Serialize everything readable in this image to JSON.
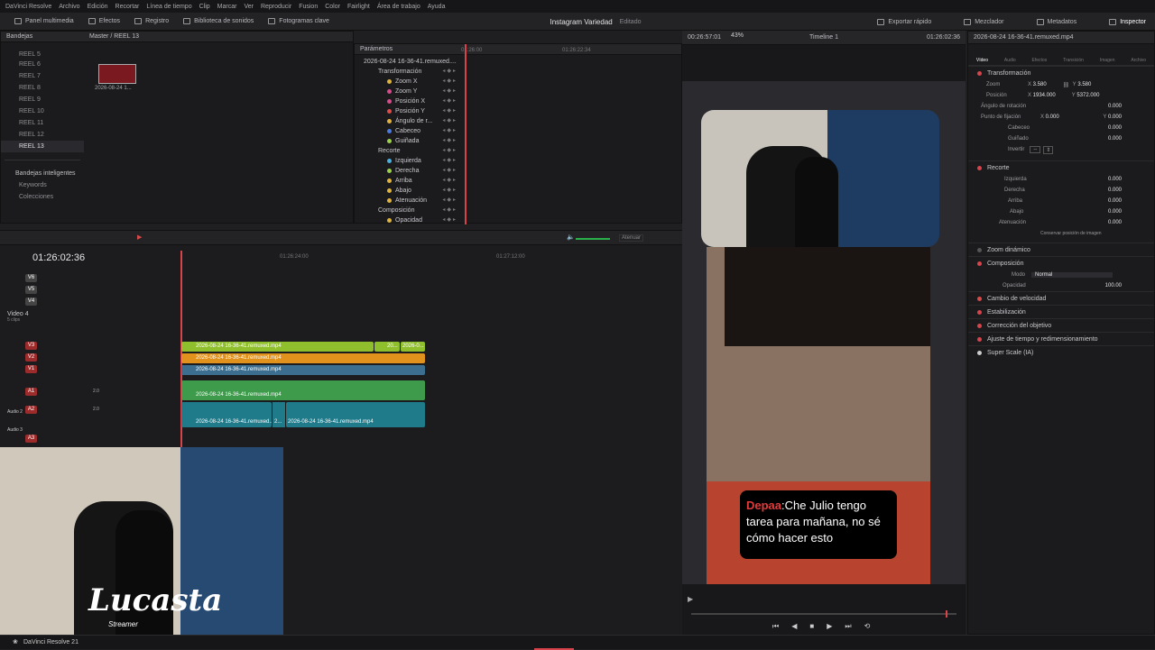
{
  "menubar": {
    "items": [
      "DaVinci Resolve",
      "Archivo",
      "Edición",
      "Recortar",
      "Línea de tiempo",
      "Clip",
      "Marcar",
      "Ver",
      "Reproducir",
      "Fusion",
      "Color",
      "Fairlight",
      "Área de trabajo",
      "Ayuda"
    ]
  },
  "toolbar": {
    "left": [
      "Panel multimedia",
      "Efectos",
      "Registro",
      "Biblioteca de sonidos",
      "Fotogramas clave"
    ],
    "right": [
      "Exportar rápido",
      "Mezclador",
      "Metadatos",
      "Inspector"
    ]
  },
  "project": {
    "title": "Instagram Variedad",
    "status": "Editado"
  },
  "mediapool": {
    "header": "Bandejas",
    "breadcrumb": "Master / REEL 13",
    "reels": [
      "REEL 5",
      "REEL 6",
      "REEL 7",
      "REEL 8",
      "REEL 9",
      "REEL 10",
      "REEL 11",
      "REEL 12",
      "REEL 13"
    ],
    "smart_bins": "Bandejas inteligentes",
    "smart_items": [
      "Keywords",
      "Colecciones"
    ],
    "thumb_label": "2026-08-24 1..."
  },
  "params": {
    "header": "Parámetros",
    "clip": "2026-08-24 16-36-41.remuxed....",
    "time1": "01:26:00",
    "time2": "01:26:22:34",
    "rows": [
      {
        "label": "Transformación",
        "group": true
      },
      {
        "label": "Zoom X",
        "color": "#e0b43c"
      },
      {
        "label": "Zoom Y",
        "color": "#d94a8c"
      },
      {
        "label": "Posición X",
        "color": "#d94a8c"
      },
      {
        "label": "Posición Y",
        "color": "#e04a4a"
      },
      {
        "label": "Ángulo de r...",
        "color": "#e0b43c"
      },
      {
        "label": "Cabeceo",
        "color": "#4a7ae0"
      },
      {
        "label": "Guiñada",
        "color": "#9bd04a"
      },
      {
        "label": "Recorte",
        "group": true
      },
      {
        "label": "Izquierda",
        "color": "#4ab0e0"
      },
      {
        "label": "Derecha",
        "color": "#9bd04a"
      },
      {
        "label": "Arriba",
        "color": "#e0b43c"
      },
      {
        "label": "Abajo",
        "color": "#e0b43c"
      },
      {
        "label": "Atenuación",
        "color": "#e0b43c"
      },
      {
        "label": "Composición",
        "group": true
      },
      {
        "label": "Opacidad",
        "color": "#e0b43c"
      }
    ]
  },
  "viewer": {
    "timecode_left": "00:26:57:01",
    "timeline": "Timeline 1",
    "timecode_right": "01:26:02:36",
    "zoom": "43%",
    "clipname": "2026-08-24 16-36-41.remuxed.mp4"
  },
  "caption": {
    "speaker": "Depaa",
    "text": "Che Julio tengo tarea para mañana, no sé cómo hacer esto"
  },
  "timeline": {
    "timecode": "01:26:02:36",
    "ruler": [
      "01:26:24:00",
      "01:27:12:00"
    ],
    "atenuar": "Atenuar",
    "tracks": [
      "V6",
      "V5",
      "V4",
      "V3",
      "V2",
      "V1",
      "A1",
      "A2",
      "A3"
    ],
    "video4_label": "Video 4",
    "video4_sub": "5 clips",
    "audio2": "Audio 2",
    "audio3": "Audio 3",
    "clips": {
      "v3": "2026-08-24 16-36-41.remuxed.mp4",
      "v3b": "20...",
      "v3c": "2026-0...",
      "v2": "2026-08-24 16-36-41.remuxed.mp4",
      "v1": "2026-08-24 16-36-41.remuxed.mp4",
      "a1": "2026-08-24 16-36-41.remuxed.mp4",
      "a2a": "2026-08-24 16-36-41.remuxed...",
      "a2b": "2...",
      "a2c": "2026-08-24 16-36-41.remuxed.mp4"
    },
    "level": "2.0"
  },
  "inspector": {
    "tabs": [
      "Vídeo",
      "Audio",
      "Efectos",
      "Transición",
      "Imagen",
      "Archivo"
    ],
    "transform": "Transformación",
    "zoom_label": "Zoom",
    "zoom_x": "3.580",
    "zoom_y": "3.580",
    "pos_label": "Posición",
    "pos_x": "1934.000",
    "pos_y": "5372.000",
    "angle": "Ángulo de rotación",
    "angle_v": "0.000",
    "anchor": "Punto de fijación",
    "anchor_x": "0.000",
    "anchor_y": "0.000",
    "pitch": "Cabeceo",
    "pitch_v": "0.000",
    "yaw": "Guiñado",
    "yaw_v": "0.000",
    "invert": "Invertir",
    "crop": "Recorte",
    "left": "Izquierda",
    "right": "Derecha",
    "top": "Arriba",
    "bottom": "Abajo",
    "soft": "Atenuación",
    "crop_v": "0.000",
    "keep": "Conservar posición de imagen",
    "dynamic": "Zoom dinámico",
    "composition": "Composición",
    "mode_label": "Modo",
    "mode": "Normal",
    "opacity_label": "Opacidad",
    "opacity": "100.00",
    "sections": [
      "Cambio de velocidad",
      "Estabilización",
      "Corrección del objetivo",
      "Ajuste de tiempo y redimensionamiento",
      "Super Scale (IA)"
    ]
  },
  "streamer": {
    "name": "Lucasta",
    "sub": "Streamer"
  },
  "footer": {
    "app": "DaVinci Resolve 21"
  }
}
